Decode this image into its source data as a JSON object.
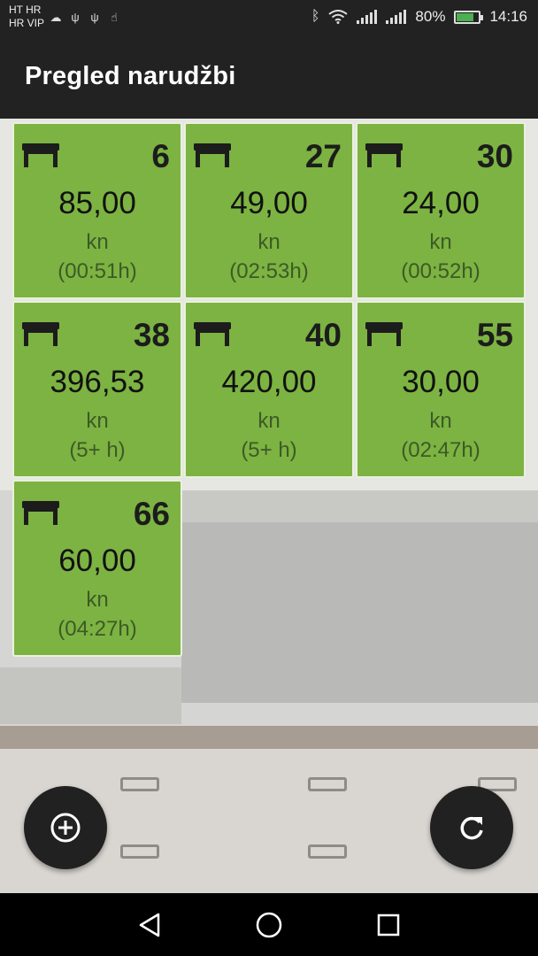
{
  "status_bar": {
    "carrier_line1": "HT HR",
    "carrier_line2": "HR VIP",
    "battery_percent_text": "80%",
    "battery_level": 0.8,
    "time": "14:16"
  },
  "app_bar": {
    "title": "Pregled narudžbi"
  },
  "colors": {
    "card_green": "#7cb342",
    "app_bar": "#222222",
    "fab": "#212121"
  },
  "tables": [
    {
      "number": "6",
      "amount": "85,00",
      "currency": "kn",
      "duration": "(00:51h)"
    },
    {
      "number": "27",
      "amount": "49,00",
      "currency": "kn",
      "duration": "(02:53h)"
    },
    {
      "number": "30",
      "amount": "24,00",
      "currency": "kn",
      "duration": "(00:52h)"
    },
    {
      "number": "38",
      "amount": "396,53",
      "currency": "kn",
      "duration": "(5+ h)"
    },
    {
      "number": "40",
      "amount": "420,00",
      "currency": "kn",
      "duration": "(5+ h)"
    },
    {
      "number": "55",
      "amount": "30,00",
      "currency": "kn",
      "duration": "(02:47h)"
    },
    {
      "number": "66",
      "amount": "60,00",
      "currency": "kn",
      "duration": "(04:27h)"
    }
  ],
  "fabs": {
    "add_icon": "add-circle-icon",
    "refresh_icon": "refresh-icon"
  },
  "nav": {
    "back_icon": "back-triangle-icon",
    "home_icon": "home-circle-icon",
    "recents_icon": "recents-square-icon"
  }
}
